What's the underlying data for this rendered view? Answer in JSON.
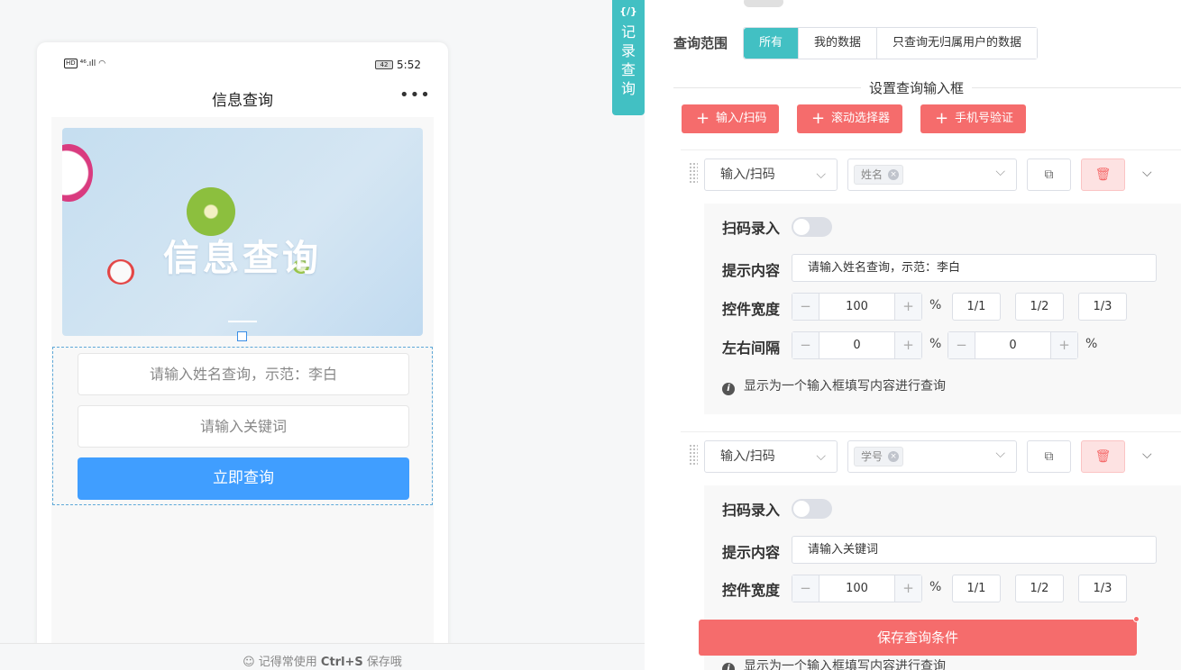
{
  "preview": {
    "status_right_battery": "42",
    "status_time": "5:52",
    "status_left": "HD ⁴⁶.ıll",
    "nav_title": "信息查询",
    "banner_text": "信息查询",
    "inputs": [
      {
        "placeholder": "请输入姓名查询，示范：李白"
      },
      {
        "placeholder": "请输入关键词"
      }
    ],
    "submit_label": "立即查询",
    "footer_hint_prefix": "记得常使用 ",
    "footer_hint_key": "Ctrl+S",
    "footer_hint_suffix": " 保存哦"
  },
  "side_tab": {
    "code": "{/}",
    "label": "记录查询"
  },
  "config": {
    "scope": {
      "label": "查询范围",
      "options": [
        "所有",
        "我的数据",
        "只查询无归属用户的数据"
      ],
      "selected": "所有"
    },
    "section_title": "设置查询输入框",
    "add_buttons": [
      "输入/扫码",
      "滚动选择器",
      "手机号验证"
    ],
    "fields": [
      {
        "type": "输入/扫码",
        "tag": "姓名",
        "scan_label": "扫码录入",
        "hint_label": "提示内容",
        "hint_value": "请输入姓名查询，示范：李白",
        "width_label": "控件宽度",
        "width_value": "100",
        "ratios": [
          "1/1",
          "1/2",
          "1/3"
        ],
        "spacing_label": "左右间隔",
        "spacing_left": "0",
        "spacing_right": "0",
        "info": "显示为一个输入框填写内容进行查询"
      },
      {
        "type": "输入/扫码",
        "tag": "学号",
        "scan_label": "扫码录入",
        "hint_label": "提示内容",
        "hint_value": "请输入关键词",
        "width_label": "控件宽度",
        "width_value": "100",
        "ratios": [
          "1/1",
          "1/2",
          "1/3"
        ],
        "info": "显示为一个输入框填写内容进行查询"
      }
    ],
    "percent_sign": "%",
    "save_label": "保存查询条件"
  },
  "colors": {
    "accent_teal": "#42c0c3",
    "danger_red": "#f56c6c",
    "primary_blue": "#409eff"
  }
}
